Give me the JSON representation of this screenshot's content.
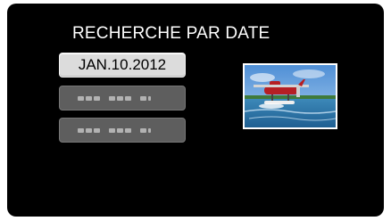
{
  "screen": {
    "title": "RECHERCHE PAR DATE"
  },
  "date_list": {
    "selected_date": "JAN.10.2012",
    "other_dates": [
      "masked-date",
      "masked-date"
    ]
  },
  "preview": {
    "description": "seaplane-thumbnail"
  }
}
